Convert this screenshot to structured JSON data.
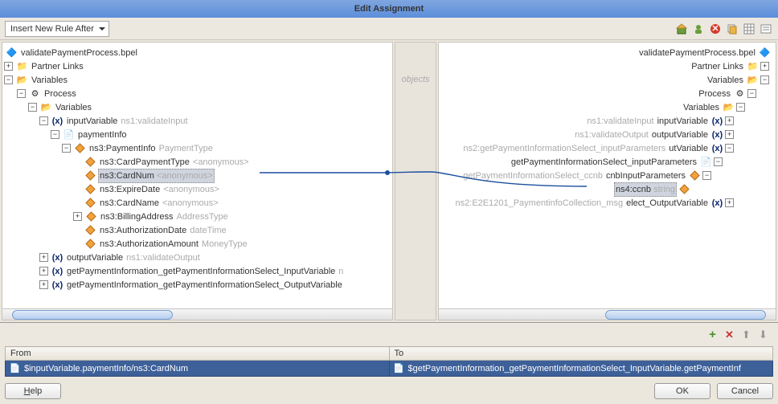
{
  "title": "Edit Assignment",
  "toolbar": {
    "rule_selector": "Insert New Rule After"
  },
  "divider_label": "objects",
  "left_tree": {
    "root_file": "validatePaymentProcess.bpel",
    "partner_links": "Partner Links",
    "variables": "Variables",
    "process": "Process",
    "process_vars": "Variables",
    "inputVariable": {
      "name": "inputVariable",
      "type": "ns1:validateInput"
    },
    "paymentInfo": "paymentInfo",
    "ns3PaymentInfo": {
      "name": "ns3:PaymentInfo",
      "type": "PaymentType"
    },
    "cardPaymentType": {
      "name": "ns3:CardPaymentType",
      "type": "<anonymous>"
    },
    "cardNum": {
      "name": "ns3:CardNum",
      "type": "<anonymous>"
    },
    "expireDate": {
      "name": "ns3:ExpireDate",
      "type": "<anonymous>"
    },
    "cardName": {
      "name": "ns3:CardName",
      "type": "<anonymous>"
    },
    "billingAddress": {
      "name": "ns3:BillingAddress",
      "type": "AddressType"
    },
    "authDate": {
      "name": "ns3:AuthorizationDate",
      "type": "dateTime"
    },
    "authAmount": {
      "name": "ns3:AuthorizationAmount",
      "type": "MoneyType"
    },
    "outputVariable": {
      "name": "outputVariable",
      "type": "ns1:validateOutput"
    },
    "gpi_input": {
      "name": "getPaymentInformation_getPaymentInformationSelect_InputVariable",
      "type": "n"
    },
    "gpi_output": {
      "name": "getPaymentInformation_getPaymentInformationSelect_OutputVariable"
    }
  },
  "right_tree": {
    "root_file": "validatePaymentProcess.bpel",
    "partner_links": "Partner Links",
    "variables": "Variables",
    "process": "Process",
    "process_vars": "Variables",
    "inputVariable": {
      "name": "inputVariable",
      "type": "ns1:validateInput"
    },
    "outputVariable": {
      "name": "outputVariable",
      "type": "ns1:validateOutput"
    },
    "utVar": {
      "name": "utVariable",
      "type": "ns2:getPaymentInformationSelect_inputParameters"
    },
    "gpi_sip": "getPaymentInformationSelect_inputParameters",
    "cnbInput": {
      "name": "cnbInputParameters",
      "type": "getPaymentInformationSelect_ccnb"
    },
    "ns4ccnb": {
      "name": "ns4:ccnb",
      "type": "string"
    },
    "elect_output": {
      "name": "elect_OutputVariable",
      "type": "ns2:E2E1201_PaymentinfoCollection_msg"
    }
  },
  "table": {
    "from_header": "From",
    "to_header": "To",
    "from_value": "$inputVariable.paymentInfo/ns3:CardNum",
    "to_value": "$getPaymentInformation_getPaymentInformationSelect_InputVariable.getPaymentInf"
  },
  "buttons": {
    "help": "Help",
    "ok": "OK",
    "cancel": "Cancel"
  },
  "icons": {
    "add": "+",
    "delete": "✕",
    "up": "⬆",
    "down": "⬇"
  }
}
